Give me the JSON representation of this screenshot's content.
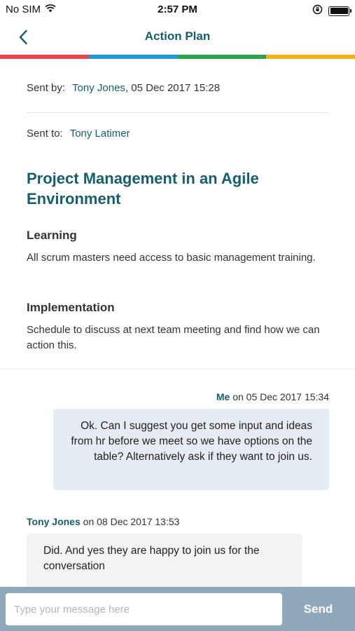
{
  "status_bar": {
    "carrier": "No SIM",
    "time": "2:57 PM",
    "wifi_icon": "wifi-icon",
    "lock_icon": "orientation-lock-icon",
    "battery_icon": "battery-icon"
  },
  "nav": {
    "title": "Action Plan",
    "back_icon": "chevron-left-icon"
  },
  "color_strip": [
    "#e8474c",
    "#1f98dd",
    "#2ba24c",
    "#f4b21c"
  ],
  "header": {
    "sent_by_label": "Sent by:",
    "sent_by_name": "Tony Jones",
    "sent_by_date": ", 05 Dec 2017 15:28",
    "sent_to_label": "Sent to:",
    "sent_to_name": "Tony Latimer"
  },
  "plan": {
    "title": "Project Management in an Agile Environment",
    "learning_heading": "Learning",
    "learning_text": "All scrum masters need access to basic management training.",
    "implementation_heading": "Implementation",
    "implementation_text": "Schedule to discuss at next team meeting and find how we can action this."
  },
  "messages": [
    {
      "author": "Me",
      "date_text": " on 05 Dec 2017 15:34",
      "text": "Ok. Can I suggest you get some input and ideas from hr before we meet so we have options on the table? Alternatively ask if they want to join us."
    },
    {
      "author": "Tony Jones",
      "date_text": " on 08 Dec 2017 13:53",
      "text": "Did. And yes they are happy to join us for the conversation"
    }
  ],
  "composer": {
    "placeholder": "Type your message here",
    "value": "",
    "send_label": "Send"
  },
  "colors": {
    "accent": "#155e6e",
    "composer_bg": "#8fa8ba",
    "my_bubble": "#e5ecf2",
    "other_bubble": "#f3f3f3"
  }
}
